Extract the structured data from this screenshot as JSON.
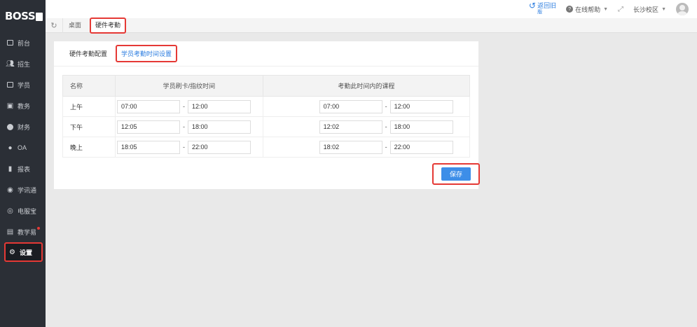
{
  "app": {
    "logo": "BOSS"
  },
  "sidebar": {
    "items": [
      {
        "label": "前台",
        "icon": "monitor-icon"
      },
      {
        "label": "招生",
        "icon": "users-icon"
      },
      {
        "label": "学员",
        "icon": "id-card-icon"
      },
      {
        "label": "教务",
        "icon": "board-icon"
      },
      {
        "label": "财务",
        "icon": "money-icon"
      },
      {
        "label": "OA",
        "icon": "chat-icon"
      },
      {
        "label": "报表",
        "icon": "bar-chart-icon"
      },
      {
        "label": "学讯通",
        "icon": "pin-icon"
      },
      {
        "label": "电服宝",
        "icon": "phone-icon"
      },
      {
        "label": "教学易",
        "icon": "book-icon"
      },
      {
        "label": "设置",
        "icon": "gear-icon"
      }
    ]
  },
  "topbar": {
    "back_label": "返回旧",
    "back_sub": "版",
    "help_label": "在线帮助",
    "campus_label": "长沙校区"
  },
  "tabs": [
    {
      "label": "桌面"
    },
    {
      "label": "硬件考勤"
    }
  ],
  "subtabs": [
    {
      "label": "硬件考勤配置"
    },
    {
      "label": "学员考勤时间设置"
    }
  ],
  "table": {
    "headers": [
      "名称",
      "学员刷卡/指纹时间",
      "考勤此时间内的课程"
    ],
    "rows": [
      {
        "name": "上午",
        "card_start": "07:00",
        "card_end": "12:00",
        "course_start": "07:00",
        "course_end": "12:00"
      },
      {
        "name": "下午",
        "card_start": "12:05",
        "card_end": "18:00",
        "course_start": "12:02",
        "course_end": "18:00"
      },
      {
        "name": "晚上",
        "card_start": "18:05",
        "card_end": "22:00",
        "course_start": "18:02",
        "course_end": "22:00"
      }
    ]
  },
  "save_label": "保存",
  "colors": {
    "sidebar_bg": "#2b2f36",
    "accent": "#3d8ee8",
    "highlight": "#e53935"
  }
}
